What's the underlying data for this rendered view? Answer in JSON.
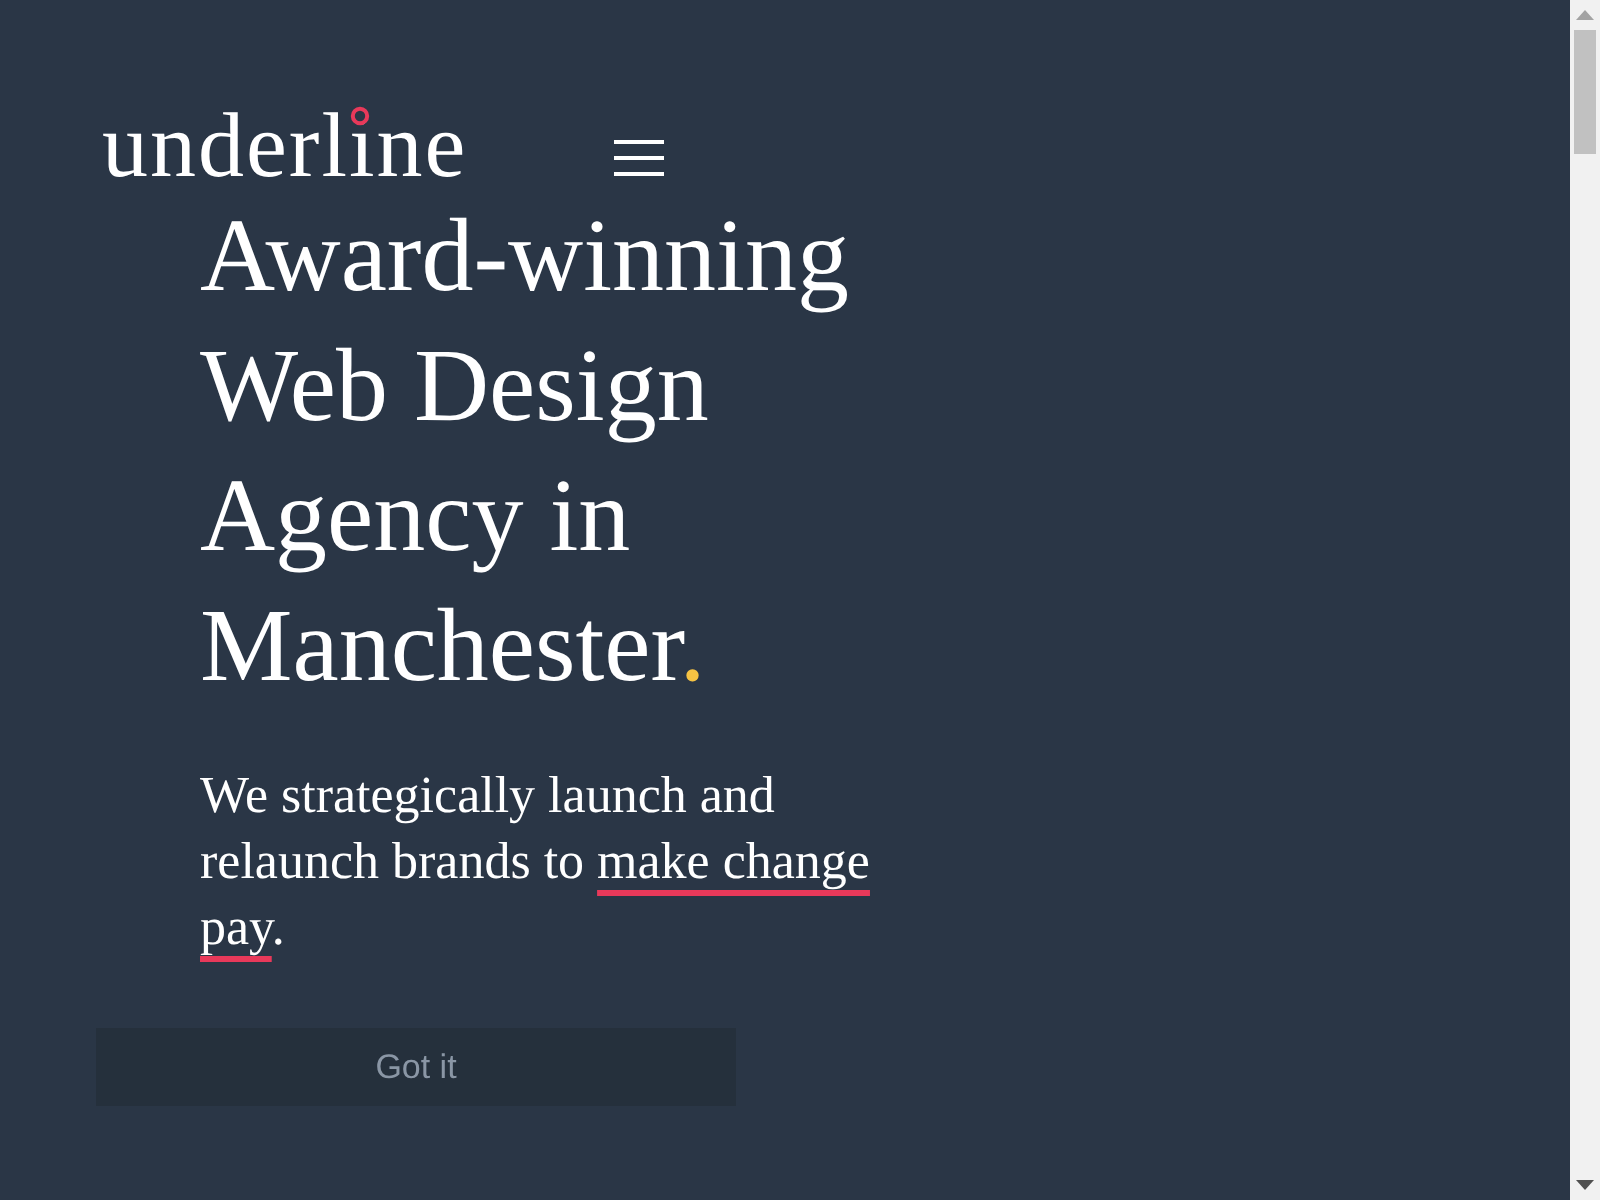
{
  "logo": {
    "text": "underline"
  },
  "hero": {
    "title": "Award-winning Web Design Agency in Manchester",
    "title_accent": ".",
    "tagline": [
      {
        "text": "We strategically launch and relaunch brands to ",
        "underlined": false
      },
      {
        "text": "make change pay",
        "underlined": true
      },
      {
        "text": ".",
        "underlined": false
      }
    ]
  },
  "cookie_button": {
    "label": "Got it"
  }
}
